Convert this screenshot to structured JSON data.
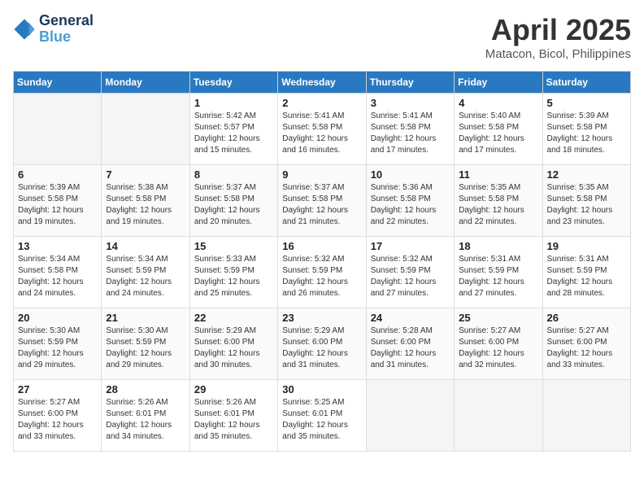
{
  "logo": {
    "line1": "General",
    "line2": "Blue"
  },
  "title": "April 2025",
  "location": "Matacon, Bicol, Philippines",
  "weekdays": [
    "Sunday",
    "Monday",
    "Tuesday",
    "Wednesday",
    "Thursday",
    "Friday",
    "Saturday"
  ],
  "weeks": [
    [
      {
        "day": "",
        "empty": true
      },
      {
        "day": "",
        "empty": true
      },
      {
        "day": "1",
        "sunrise": "Sunrise: 5:42 AM",
        "sunset": "Sunset: 5:57 PM",
        "daylight": "Daylight: 12 hours and 15 minutes."
      },
      {
        "day": "2",
        "sunrise": "Sunrise: 5:41 AM",
        "sunset": "Sunset: 5:58 PM",
        "daylight": "Daylight: 12 hours and 16 minutes."
      },
      {
        "day": "3",
        "sunrise": "Sunrise: 5:41 AM",
        "sunset": "Sunset: 5:58 PM",
        "daylight": "Daylight: 12 hours and 17 minutes."
      },
      {
        "day": "4",
        "sunrise": "Sunrise: 5:40 AM",
        "sunset": "Sunset: 5:58 PM",
        "daylight": "Daylight: 12 hours and 17 minutes."
      },
      {
        "day": "5",
        "sunrise": "Sunrise: 5:39 AM",
        "sunset": "Sunset: 5:58 PM",
        "daylight": "Daylight: 12 hours and 18 minutes."
      }
    ],
    [
      {
        "day": "6",
        "sunrise": "Sunrise: 5:39 AM",
        "sunset": "Sunset: 5:58 PM",
        "daylight": "Daylight: 12 hours and 19 minutes."
      },
      {
        "day": "7",
        "sunrise": "Sunrise: 5:38 AM",
        "sunset": "Sunset: 5:58 PM",
        "daylight": "Daylight: 12 hours and 19 minutes."
      },
      {
        "day": "8",
        "sunrise": "Sunrise: 5:37 AM",
        "sunset": "Sunset: 5:58 PM",
        "daylight": "Daylight: 12 hours and 20 minutes."
      },
      {
        "day": "9",
        "sunrise": "Sunrise: 5:37 AM",
        "sunset": "Sunset: 5:58 PM",
        "daylight": "Daylight: 12 hours and 21 minutes."
      },
      {
        "day": "10",
        "sunrise": "Sunrise: 5:36 AM",
        "sunset": "Sunset: 5:58 PM",
        "daylight": "Daylight: 12 hours and 22 minutes."
      },
      {
        "day": "11",
        "sunrise": "Sunrise: 5:35 AM",
        "sunset": "Sunset: 5:58 PM",
        "daylight": "Daylight: 12 hours and 22 minutes."
      },
      {
        "day": "12",
        "sunrise": "Sunrise: 5:35 AM",
        "sunset": "Sunset: 5:58 PM",
        "daylight": "Daylight: 12 hours and 23 minutes."
      }
    ],
    [
      {
        "day": "13",
        "sunrise": "Sunrise: 5:34 AM",
        "sunset": "Sunset: 5:58 PM",
        "daylight": "Daylight: 12 hours and 24 minutes."
      },
      {
        "day": "14",
        "sunrise": "Sunrise: 5:34 AM",
        "sunset": "Sunset: 5:59 PM",
        "daylight": "Daylight: 12 hours and 24 minutes."
      },
      {
        "day": "15",
        "sunrise": "Sunrise: 5:33 AM",
        "sunset": "Sunset: 5:59 PM",
        "daylight": "Daylight: 12 hours and 25 minutes."
      },
      {
        "day": "16",
        "sunrise": "Sunrise: 5:32 AM",
        "sunset": "Sunset: 5:59 PM",
        "daylight": "Daylight: 12 hours and 26 minutes."
      },
      {
        "day": "17",
        "sunrise": "Sunrise: 5:32 AM",
        "sunset": "Sunset: 5:59 PM",
        "daylight": "Daylight: 12 hours and 27 minutes."
      },
      {
        "day": "18",
        "sunrise": "Sunrise: 5:31 AM",
        "sunset": "Sunset: 5:59 PM",
        "daylight": "Daylight: 12 hours and 27 minutes."
      },
      {
        "day": "19",
        "sunrise": "Sunrise: 5:31 AM",
        "sunset": "Sunset: 5:59 PM",
        "daylight": "Daylight: 12 hours and 28 minutes."
      }
    ],
    [
      {
        "day": "20",
        "sunrise": "Sunrise: 5:30 AM",
        "sunset": "Sunset: 5:59 PM",
        "daylight": "Daylight: 12 hours and 29 minutes."
      },
      {
        "day": "21",
        "sunrise": "Sunrise: 5:30 AM",
        "sunset": "Sunset: 5:59 PM",
        "daylight": "Daylight: 12 hours and 29 minutes."
      },
      {
        "day": "22",
        "sunrise": "Sunrise: 5:29 AM",
        "sunset": "Sunset: 6:00 PM",
        "daylight": "Daylight: 12 hours and 30 minutes."
      },
      {
        "day": "23",
        "sunrise": "Sunrise: 5:29 AM",
        "sunset": "Sunset: 6:00 PM",
        "daylight": "Daylight: 12 hours and 31 minutes."
      },
      {
        "day": "24",
        "sunrise": "Sunrise: 5:28 AM",
        "sunset": "Sunset: 6:00 PM",
        "daylight": "Daylight: 12 hours and 31 minutes."
      },
      {
        "day": "25",
        "sunrise": "Sunrise: 5:27 AM",
        "sunset": "Sunset: 6:00 PM",
        "daylight": "Daylight: 12 hours and 32 minutes."
      },
      {
        "day": "26",
        "sunrise": "Sunrise: 5:27 AM",
        "sunset": "Sunset: 6:00 PM",
        "daylight": "Daylight: 12 hours and 33 minutes."
      }
    ],
    [
      {
        "day": "27",
        "sunrise": "Sunrise: 5:27 AM",
        "sunset": "Sunset: 6:00 PM",
        "daylight": "Daylight: 12 hours and 33 minutes."
      },
      {
        "day": "28",
        "sunrise": "Sunrise: 5:26 AM",
        "sunset": "Sunset: 6:01 PM",
        "daylight": "Daylight: 12 hours and 34 minutes."
      },
      {
        "day": "29",
        "sunrise": "Sunrise: 5:26 AM",
        "sunset": "Sunset: 6:01 PM",
        "daylight": "Daylight: 12 hours and 35 minutes."
      },
      {
        "day": "30",
        "sunrise": "Sunrise: 5:25 AM",
        "sunset": "Sunset: 6:01 PM",
        "daylight": "Daylight: 12 hours and 35 minutes."
      },
      {
        "day": "",
        "empty": true
      },
      {
        "day": "",
        "empty": true
      },
      {
        "day": "",
        "empty": true
      }
    ]
  ]
}
